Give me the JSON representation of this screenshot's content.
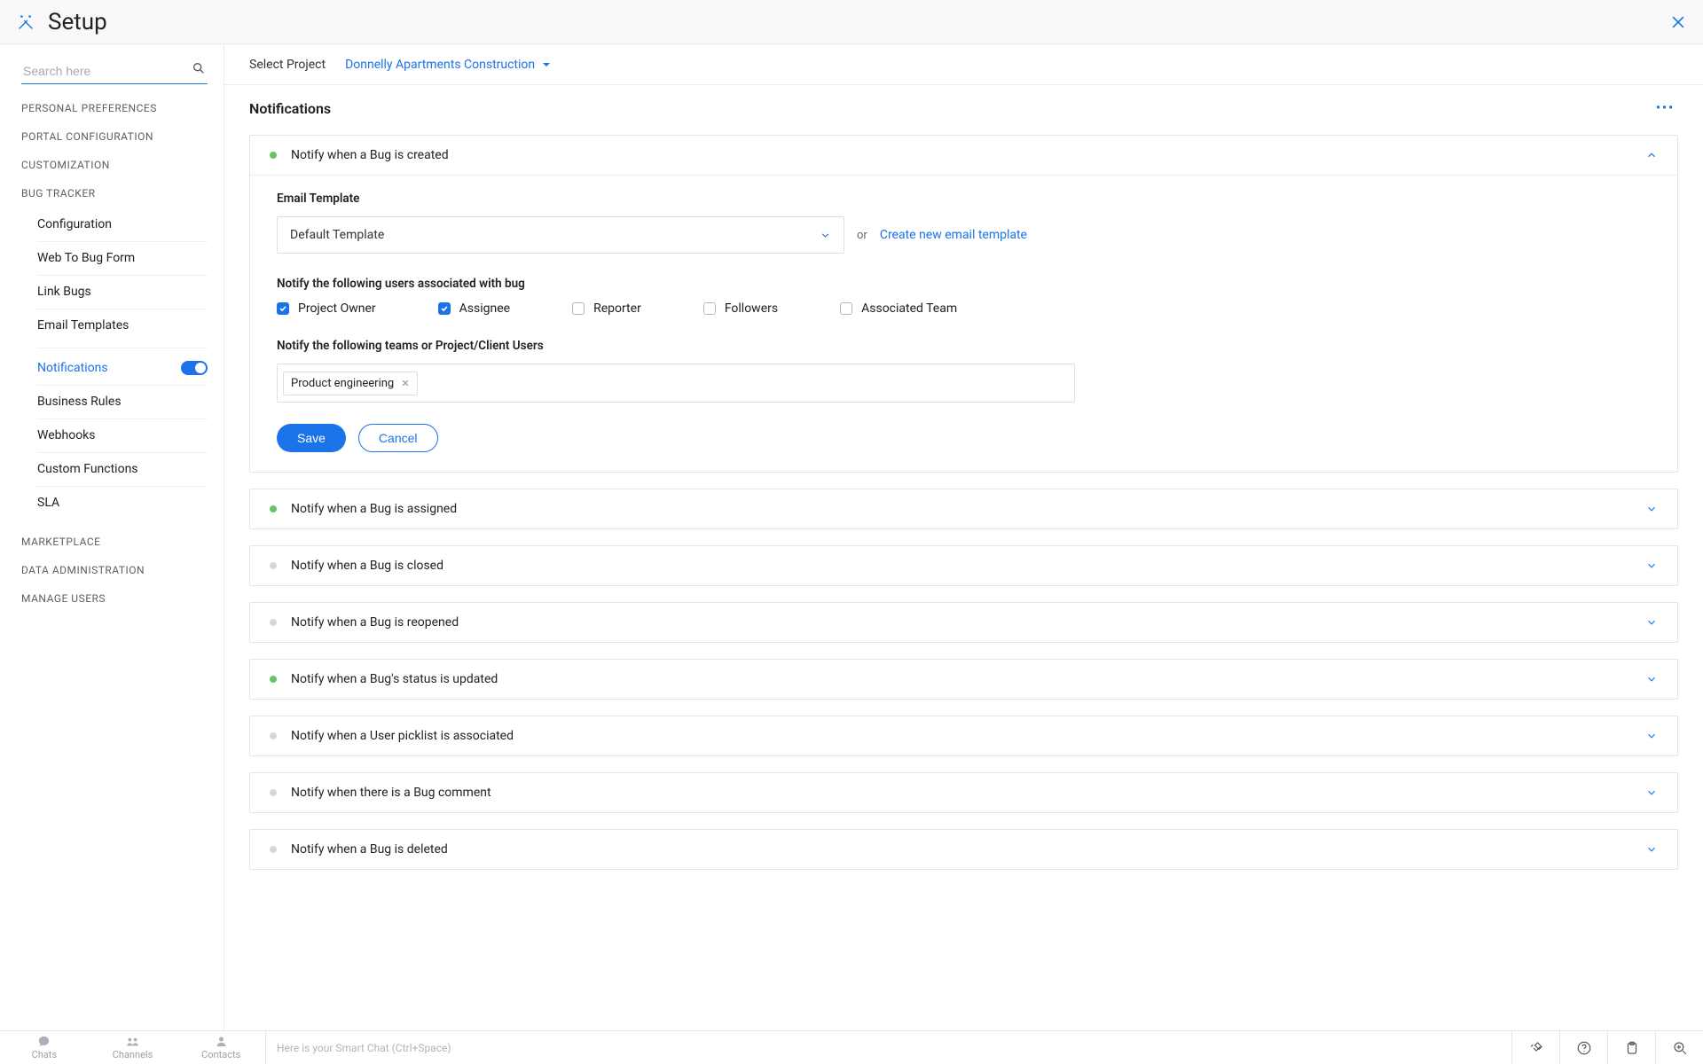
{
  "header": {
    "title": "Setup"
  },
  "search": {
    "placeholder": "Search here"
  },
  "sidebar": {
    "categories": {
      "personal": "PERSONAL PREFERENCES",
      "portal": "PORTAL CONFIGURATION",
      "custom": "CUSTOMIZATION",
      "bug": "BUG TRACKER",
      "market": "MARKETPLACE",
      "dataadmin": "DATA ADMINISTRATION",
      "users": "MANAGE USERS"
    },
    "bugItems": {
      "config": "Configuration",
      "webform": "Web To Bug Form",
      "link": "Link Bugs",
      "tmpl": "Email Templates",
      "notif": "Notifications",
      "brules": "Business Rules",
      "webhooks": "Webhooks",
      "cfn": "Custom Functions",
      "sla": "SLA"
    }
  },
  "projectBar": {
    "label": "Select Project",
    "name": "Donnelly Apartments Construction"
  },
  "page": {
    "title": "Notifications"
  },
  "expanded": {
    "title": "Notify when a Bug is created",
    "emailTemplateLabel": "Email Template",
    "emailTemplateValue": "Default Template",
    "orText": "or",
    "createLink": "Create new email template",
    "usersLabel": "Notify the following users associated with bug",
    "checks": {
      "owner": "Project Owner",
      "assignee": "Assignee",
      "reporter": "Reporter",
      "followers": "Followers",
      "team": "Associated Team"
    },
    "teamsLabel": "Notify the following teams or Project/Client Users",
    "chip": "Product engineering",
    "save": "Save",
    "cancel": "Cancel"
  },
  "rules": [
    {
      "title": "Notify when a Bug is assigned",
      "on": true
    },
    {
      "title": "Notify when a Bug is closed",
      "on": false
    },
    {
      "title": "Notify when a Bug is reopened",
      "on": false
    },
    {
      "title": "Notify when a Bug's status is updated",
      "on": true
    },
    {
      "title": "Notify when a User picklist is associated",
      "on": false
    },
    {
      "title": "Notify when there is a Bug comment",
      "on": false
    },
    {
      "title": "Notify when a Bug is deleted",
      "on": false
    }
  ],
  "bottom": {
    "tabs": {
      "chats": "Chats",
      "channels": "Channels",
      "contacts": "Contacts"
    },
    "hint": "Here is your Smart Chat (Ctrl+Space)"
  }
}
